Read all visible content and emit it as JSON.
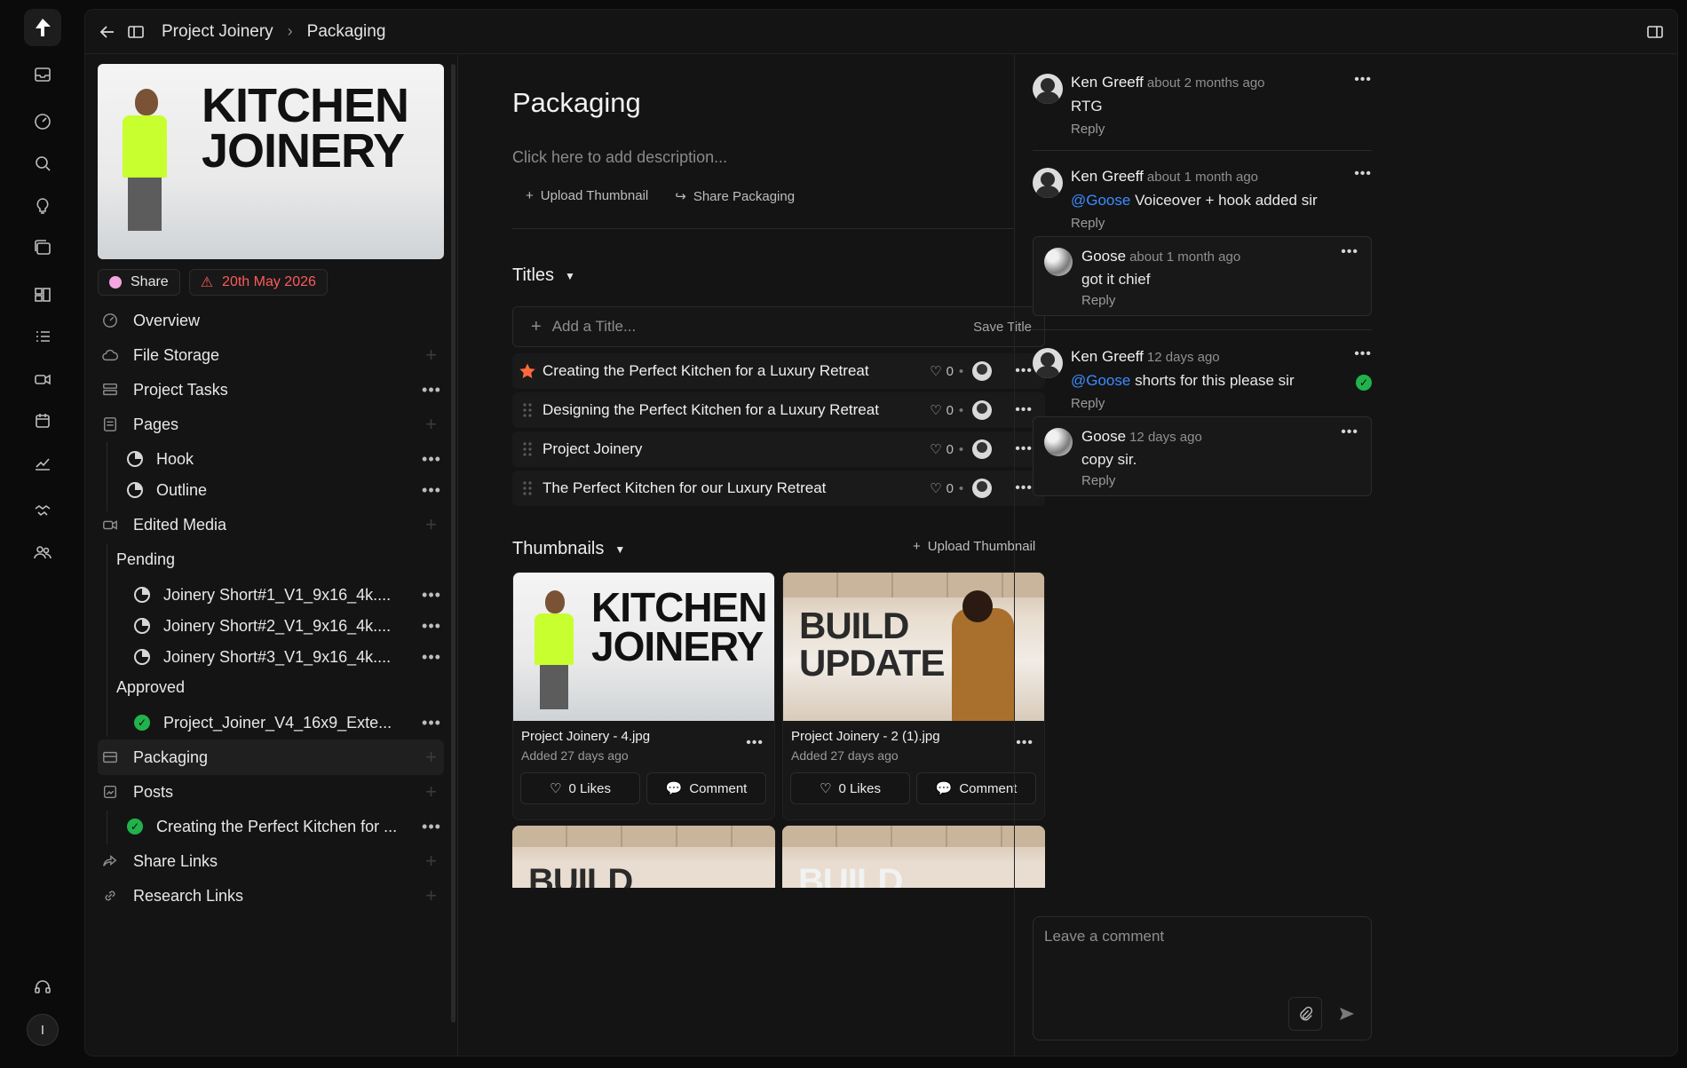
{
  "breadcrumb": {
    "project": "Project Joinery",
    "current": "Packaging"
  },
  "hero": {
    "line1": "KITCHEN",
    "line2": "JOINERY"
  },
  "chips": {
    "share": "Share",
    "due": "20th May 2026"
  },
  "nav": {
    "overview": "Overview",
    "file_storage": "File Storage",
    "project_tasks": "Project Tasks",
    "pages": "Pages",
    "hook": "Hook",
    "outline": "Outline",
    "edited_media": "Edited Media",
    "pending": "Pending",
    "pending_items": [
      "Joinery Short#1_V1_9x16_4k....",
      "Joinery Short#2_V1_9x16_4k....",
      "Joinery Short#3_V1_9x16_4k...."
    ],
    "approved": "Approved",
    "approved_items": [
      "Project_Joiner_V4_16x9_Exte..."
    ],
    "packaging": "Packaging",
    "posts": "Posts",
    "posts_items": [
      "Creating the Perfect Kitchen for ..."
    ],
    "share_links": "Share Links",
    "research_links": "Research Links",
    "more": "•••",
    "plus": "+"
  },
  "main": {
    "title": "Packaging",
    "description_placeholder": "Click here to add description...",
    "upload_thumbnail": "Upload Thumbnail",
    "share_packaging": "Share Packaging",
    "titles_heading": "Titles",
    "add_title_placeholder": "Add a Title...",
    "save_title": "Save Title",
    "titles": [
      {
        "text": "Creating the Perfect Kitchen for a Luxury Retreat",
        "likes": "0",
        "starred": true
      },
      {
        "text": "Designing the Perfect Kitchen for a Luxury Retreat",
        "likes": "0",
        "starred": false
      },
      {
        "text": "Project Joinery",
        "likes": "0",
        "starred": false
      },
      {
        "text": "The Perfect Kitchen for our Luxury Retreat",
        "likes": "0",
        "starred": false
      }
    ],
    "thumbnails_heading": "Thumbnails",
    "thumbnails_upload": "Upload Thumbnail",
    "thumbnails": [
      {
        "name": "Project Joinery - 4.jpg",
        "added": "Added 27 days ago",
        "likes": "0 Likes",
        "comment": "Comment",
        "line1": "KITCHEN",
        "line2": "JOINERY"
      },
      {
        "name": "Project Joinery - 2 (1).jpg",
        "added": "Added 27 days ago",
        "likes": "0 Likes",
        "comment": "Comment",
        "line1": "BUILD",
        "line2": "UPDATE"
      }
    ],
    "partial_thumb_text": "BUILD"
  },
  "comments": [
    {
      "author": "Ken Greeff",
      "time": "about 2 months ago",
      "mention": "",
      "text": "RTG",
      "reply": "Reply"
    },
    {
      "author": "Ken Greeff",
      "time": "about 1 month ago",
      "mention": "@Goose",
      "text": "Voiceover + hook added sir",
      "reply": "Reply",
      "replies": [
        {
          "author": "Goose",
          "time": "about 1 month ago",
          "text": "got it chief",
          "reply": "Reply"
        }
      ]
    },
    {
      "author": "Ken Greeff",
      "time": "12 days ago",
      "mention": "@Goose",
      "text": "shorts for this please sir",
      "reply": "Reply",
      "resolved": true,
      "replies": [
        {
          "author": "Goose",
          "time": "12 days ago",
          "text": "copy sir.",
          "reply": "Reply"
        }
      ]
    }
  ],
  "compose": {
    "placeholder": "Leave a comment"
  },
  "rail": {
    "user_initial": "I"
  },
  "colors": {
    "accent_blue": "#3d8bff",
    "green": "#21b24b",
    "danger": "#ff5a5a",
    "star": "#ff6a3d"
  }
}
